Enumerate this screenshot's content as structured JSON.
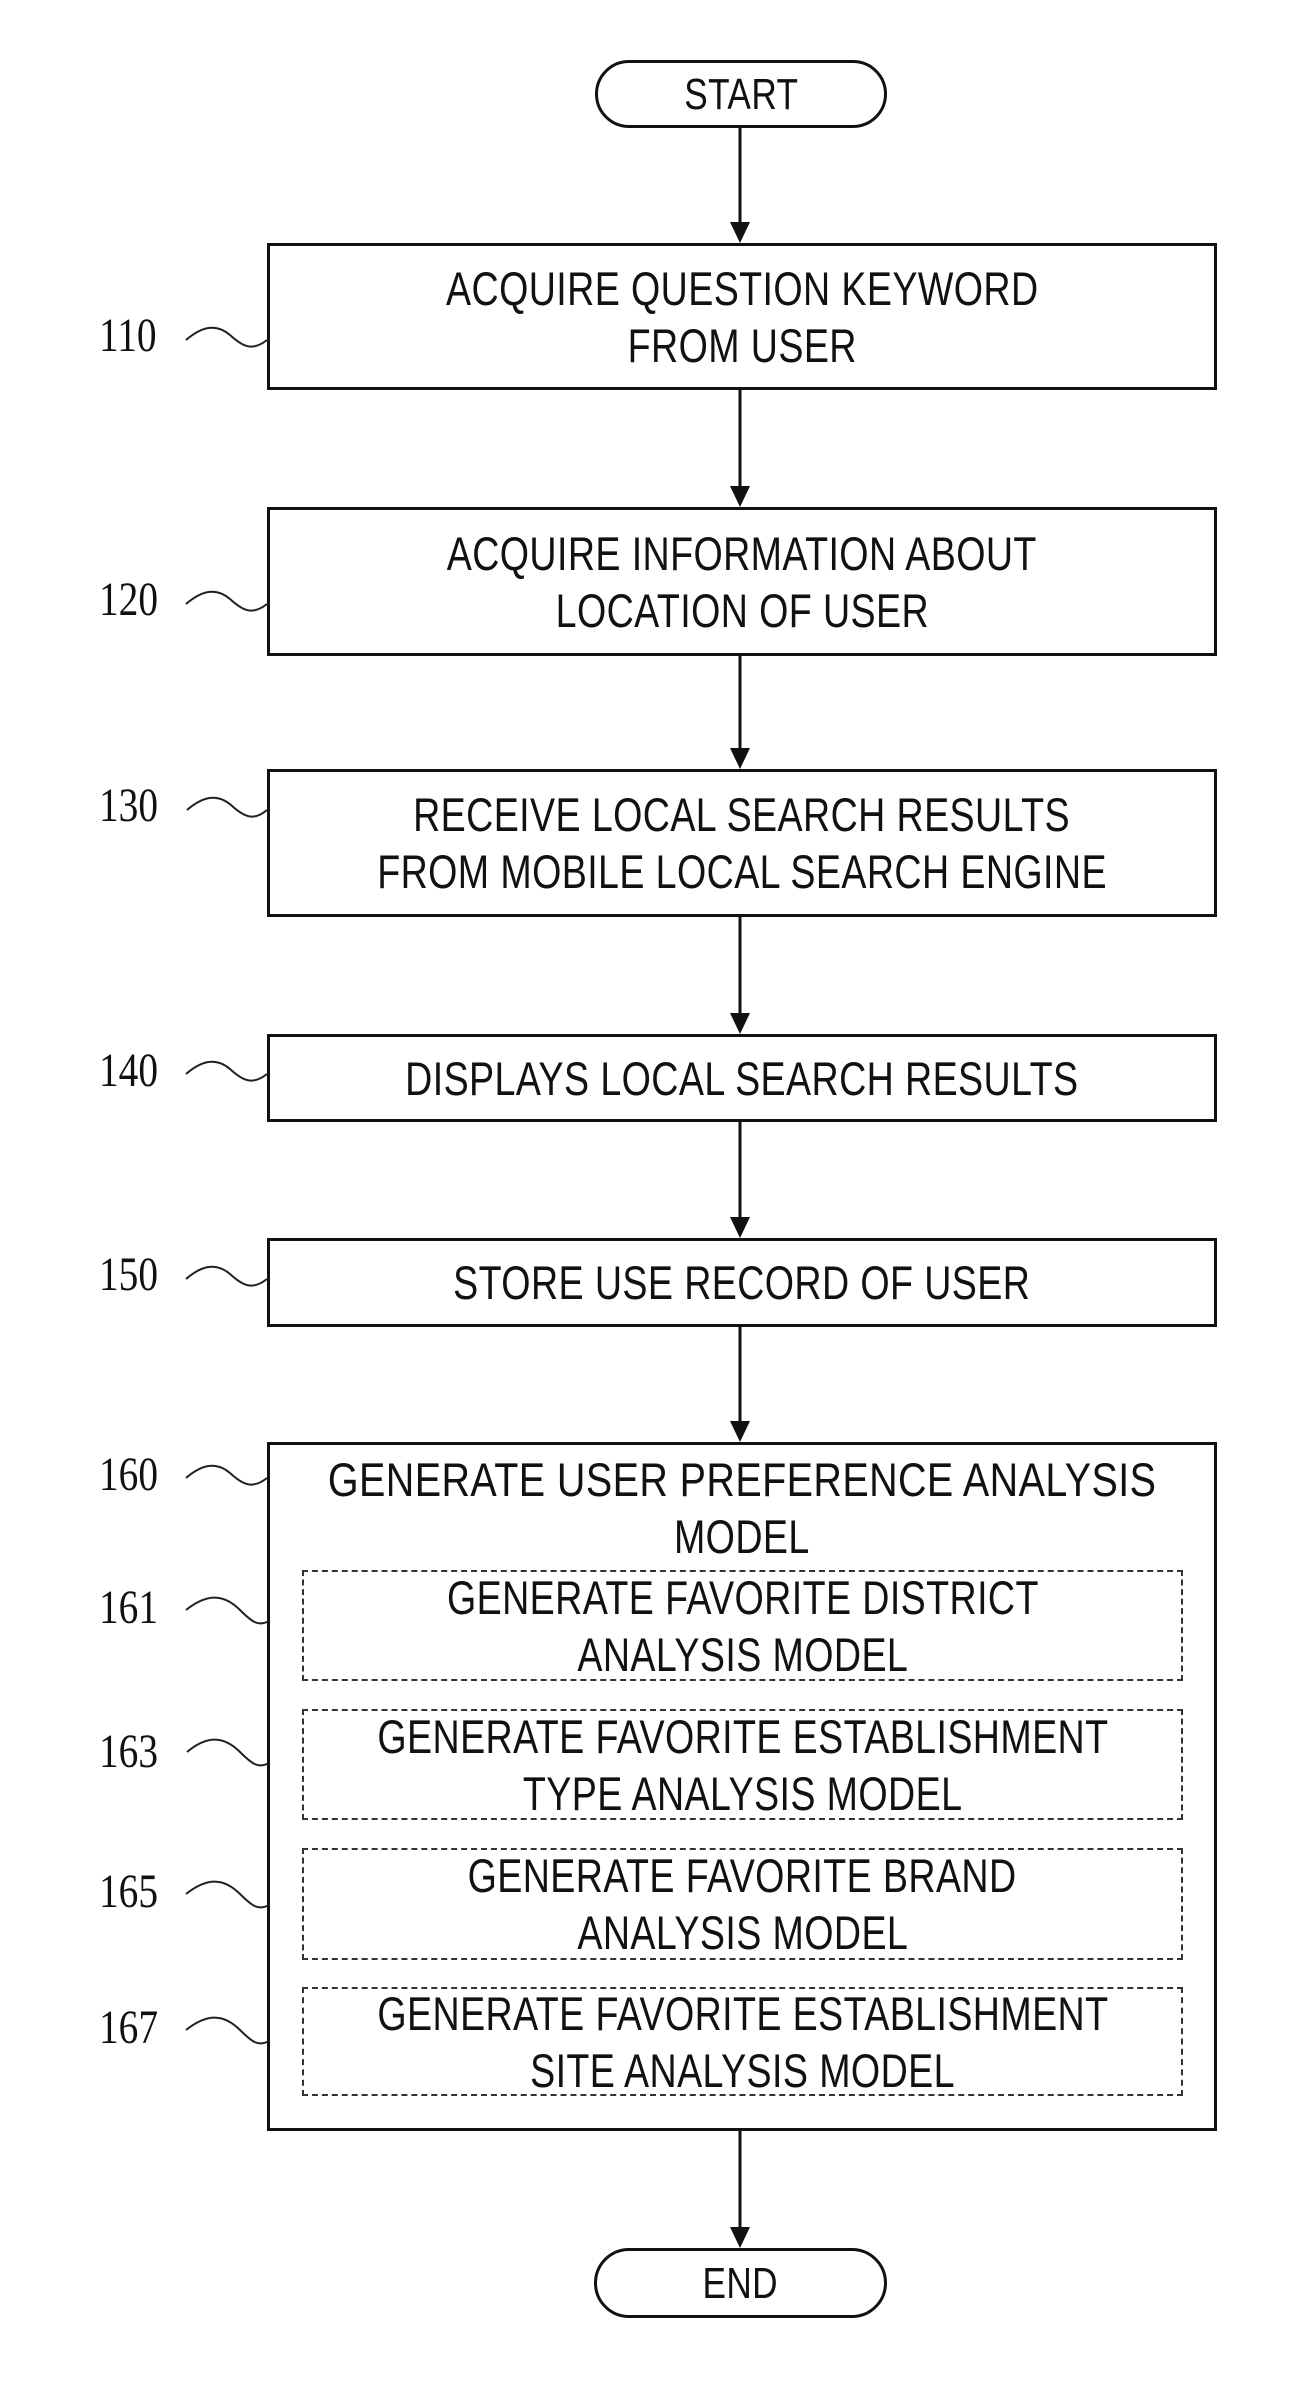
{
  "figure": {
    "type": "flowchart",
    "start": "START",
    "end": "END",
    "steps": [
      {
        "ref": "110",
        "lines": [
          "ACQUIRE QUESTION KEYWORD",
          "FROM USER"
        ]
      },
      {
        "ref": "120",
        "lines": [
          "ACQUIRE INFORMATION ABOUT",
          "LOCATION OF USER"
        ]
      },
      {
        "ref": "130",
        "lines": [
          "RECEIVE LOCAL SEARCH RESULTS",
          "FROM MOBILE LOCAL SEARCH ENGINE"
        ]
      },
      {
        "ref": "140",
        "lines": [
          "DISPLAYS LOCAL SEARCH RESULTS"
        ]
      },
      {
        "ref": "150",
        "lines": [
          "STORE USE RECORD OF USER"
        ]
      },
      {
        "ref": "160",
        "lines": [
          "GENERATE USER PREFERENCE ANALYSIS",
          "MODEL"
        ],
        "substeps": [
          {
            "ref": "161",
            "lines": [
              "GENERATE FAVORITE DISTRICT",
              "ANALYSIS MODEL"
            ]
          },
          {
            "ref": "163",
            "lines": [
              "GENERATE FAVORITE ESTABLISHMENT",
              "TYPE ANALYSIS MODEL"
            ]
          },
          {
            "ref": "165",
            "lines": [
              "GENERATE FAVORITE BRAND",
              "ANALYSIS MODEL"
            ]
          },
          {
            "ref": "167",
            "lines": [
              "GENERATE FAVORITE ESTABLISHMENT",
              "SITE ANALYSIS MODEL"
            ]
          }
        ]
      }
    ]
  }
}
